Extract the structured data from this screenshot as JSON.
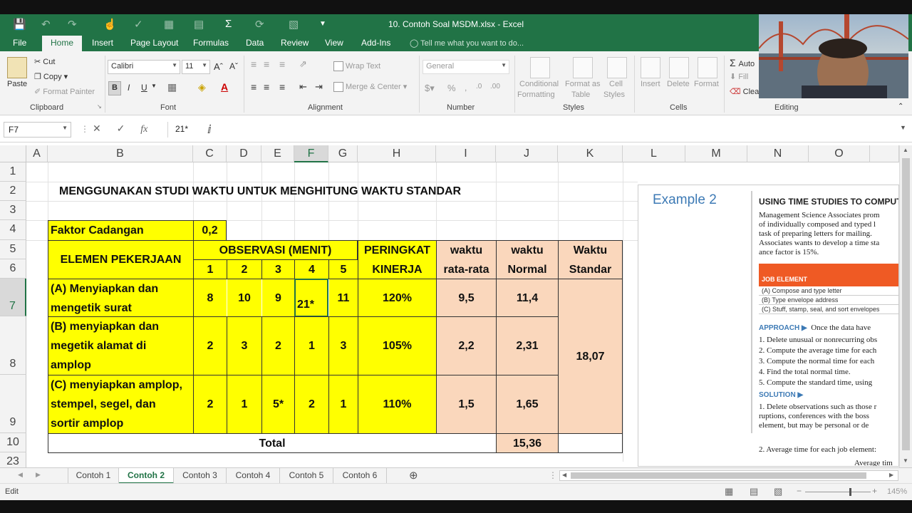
{
  "window": {
    "title": "10. Contoh Soal MSDM.xlsx - Excel"
  },
  "ribbon_tabs": [
    "File",
    "Home",
    "Insert",
    "Page Layout",
    "Formulas",
    "Data",
    "Review",
    "View",
    "Add-Ins"
  ],
  "tell_me": "Tell me what you want to do...",
  "clipboard": {
    "paste": "Paste",
    "cut": "Cut",
    "copy": "Copy",
    "format_painter": "Format Painter",
    "label": "Clipboard"
  },
  "font": {
    "name": "Calibri",
    "size": "11",
    "label": "Font",
    "bold": "B",
    "italic": "I",
    "underline": "U"
  },
  "alignment": {
    "wrap": "Wrap Text",
    "merge": "Merge & Center",
    "label": "Alignment"
  },
  "number": {
    "format": "General",
    "label": "Number"
  },
  "styles": {
    "conditional": "Conditional",
    "formatting": "Formatting",
    "format_as": "Format as",
    "table": "Table",
    "cell": "Cell",
    "cell_styles": "Styles",
    "label": "Styles"
  },
  "cells": {
    "insert": "Insert",
    "delete": "Delete",
    "format": "Format",
    "label": "Cells"
  },
  "editing": {
    "autosum": "Auto",
    "fill": "Fill",
    "clear": "Clea",
    "label": "Editing"
  },
  "formula_bar": {
    "name_box": "F7",
    "value": "21*"
  },
  "columns": [
    "A",
    "B",
    "C",
    "D",
    "E",
    "F",
    "G",
    "H",
    "I",
    "J",
    "K",
    "L",
    "M",
    "N",
    "O"
  ],
  "rows": [
    "1",
    "2",
    "3",
    "4",
    "5",
    "6",
    "7",
    "8",
    "9",
    "10",
    "23"
  ],
  "sheet": {
    "title": "MENGGUNAKAN STUDI WAKTU UNTUK MENGHITUNG WAKTU STANDAR",
    "faktor_label": "Faktor Cadangan",
    "faktor_value": "0,2",
    "elemen_header": "ELEMEN PEKERJAAN",
    "observasi_header": "OBSERVASI (MENIT)",
    "obs_numbers": [
      "1",
      "2",
      "3",
      "4",
      "5"
    ],
    "peringkat_1": "PERINGKAT",
    "peringkat_2": "KINERJA",
    "rata_1": "waktu",
    "rata_2": "rata-rata",
    "normal_1": "waktu",
    "normal_2": "Normal",
    "standar_1": "Waktu",
    "standar_2": "Standar",
    "tasks": [
      {
        "l1": "(A) Menyiapkan dan",
        "l2": "mengetik surat",
        "l3": "",
        "obs": [
          "8",
          "10",
          "9",
          "21*",
          "11"
        ],
        "rating": "120%",
        "avg": "9,5",
        "normal": "11,4"
      },
      {
        "l1": "(B) menyiapkan dan",
        "l2": "megetik alamat di",
        "l3": "amplop",
        "obs": [
          "2",
          "3",
          "2",
          "1",
          "3"
        ],
        "rating": "105%",
        "avg": "2,2",
        "normal": "2,31"
      },
      {
        "l1": "(C) menyiapkan amplop,",
        "l2": "stempel, segel, dan",
        "l3": "sortir amplop",
        "obs": [
          "2",
          "1",
          "5*",
          "2",
          "1"
        ],
        "rating": "110%",
        "avg": "1,5",
        "normal": "1,65"
      }
    ],
    "standar_value": "18,07",
    "total_label": "Total",
    "total_value": "15,36"
  },
  "book": {
    "example": "Example 2",
    "heading": "USING TIME STUDIES TO COMPUTE",
    "para": [
      "Management Science Associates prom",
      "of individually composed and typed l",
      "task of preparing letters for mailing.",
      "Associates wants to develop a time sta",
      "ance factor is 15%."
    ],
    "table_head": "JOB ELEMENT",
    "table_rows": [
      "(A) Compose and type letter",
      "(B) Type envelope address",
      "(C) Stuff, stamp, seal, and sort envelopes"
    ],
    "approach": "APPROACH ▶",
    "approach_text": "Once the data have",
    "steps": [
      "1.  Delete unusual or nonrecurring obs",
      "2.  Compute the average time for each",
      "3.  Compute the normal time for each",
      "4.  Find the total normal time.",
      "5.  Compute the standard time, using"
    ],
    "solution": "SOLUTION ▶",
    "sol_lines": [
      "1.  Delete observations such as those r",
      "ruptions, conferences with the boss",
      "element, but may be personal or de"
    ],
    "step2": "2.  Average time for each job element:",
    "avg_tim": "Average tim"
  },
  "sheet_tabs": [
    "Contoh 1",
    "Contoh 2",
    "Contoh 3",
    "Contoh 4",
    "Contoh 5",
    "Contoh 6"
  ],
  "status": {
    "mode": "Edit",
    "zoom": "145%"
  }
}
